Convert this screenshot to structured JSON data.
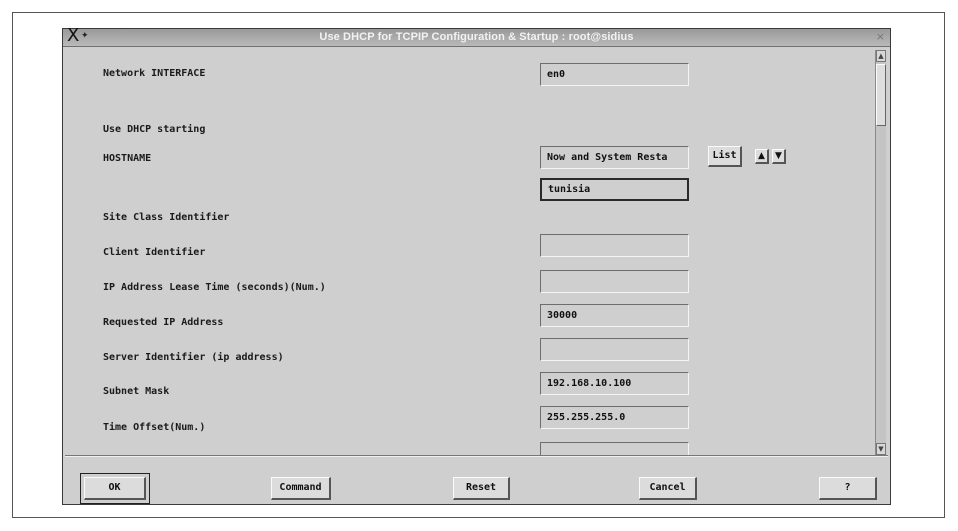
{
  "window": {
    "title": "Use DHCP for TCPIP Configuration & Startup : root@sidius",
    "x_glyph": "X",
    "pin_glyph": "✦",
    "close_glyph": "×"
  },
  "form": {
    "fields": [
      {
        "label": "Network INTERFACE",
        "value": ""
      },
      {
        "label": "Use DHCP starting",
        "value": "Now and System Resta"
      },
      {
        "label": "HOSTNAME",
        "value": "tunisia"
      },
      {
        "label": "Site Class Identifier",
        "value": ""
      },
      {
        "label": "Client Identifier",
        "value": ""
      },
      {
        "label": "IP Address Lease Time (seconds)(Num.)",
        "value": "30000"
      },
      {
        "label": "Requested IP Address",
        "value": ""
      },
      {
        "label": "Server Identifier (ip address)",
        "value": "192.168.10.100"
      },
      {
        "label": "Subnet Mask",
        "value": "255.255.255.0"
      },
      {
        "label": "Time Offset(Num.)",
        "value": ""
      }
    ],
    "interface_value": "en0",
    "list_button": "List",
    "arrow_up": "▲",
    "arrow_down": "▼"
  },
  "buttons": {
    "ok": "OK",
    "command": "Command",
    "reset": "Reset",
    "cancel": "Cancel",
    "help": "?"
  }
}
